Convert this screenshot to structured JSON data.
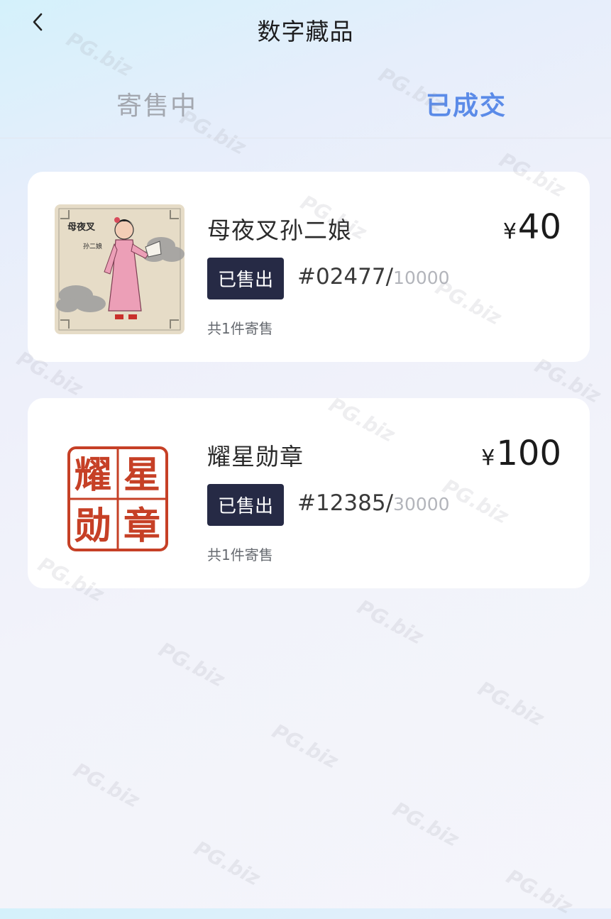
{
  "header": {
    "title": "数字藏品",
    "back_icon": "chevron-left-icon"
  },
  "tabs": [
    {
      "label": "寄售中",
      "active": false
    },
    {
      "label": "已成交",
      "active": true
    }
  ],
  "accent_color": "#5b8be8",
  "items": [
    {
      "image": "portrait of 母夜叉孙二娘 with clouds",
      "image_text": [
        "母夜叉",
        "孙二娘"
      ],
      "name": "母夜叉孙二娘",
      "currency": "¥",
      "price": "40",
      "status": "已售出",
      "serial": "#02477/",
      "total": "10000",
      "count": "共1件寄售"
    },
    {
      "image": "red seal stamp",
      "image_text": [
        "耀",
        "星",
        "勋",
        "章"
      ],
      "name": "耀星勋章",
      "currency": "¥",
      "price": "100",
      "status": "已售出",
      "serial": "#12385/",
      "total": "30000",
      "count": "共1件寄售"
    }
  ],
  "watermark": "PG.biz"
}
